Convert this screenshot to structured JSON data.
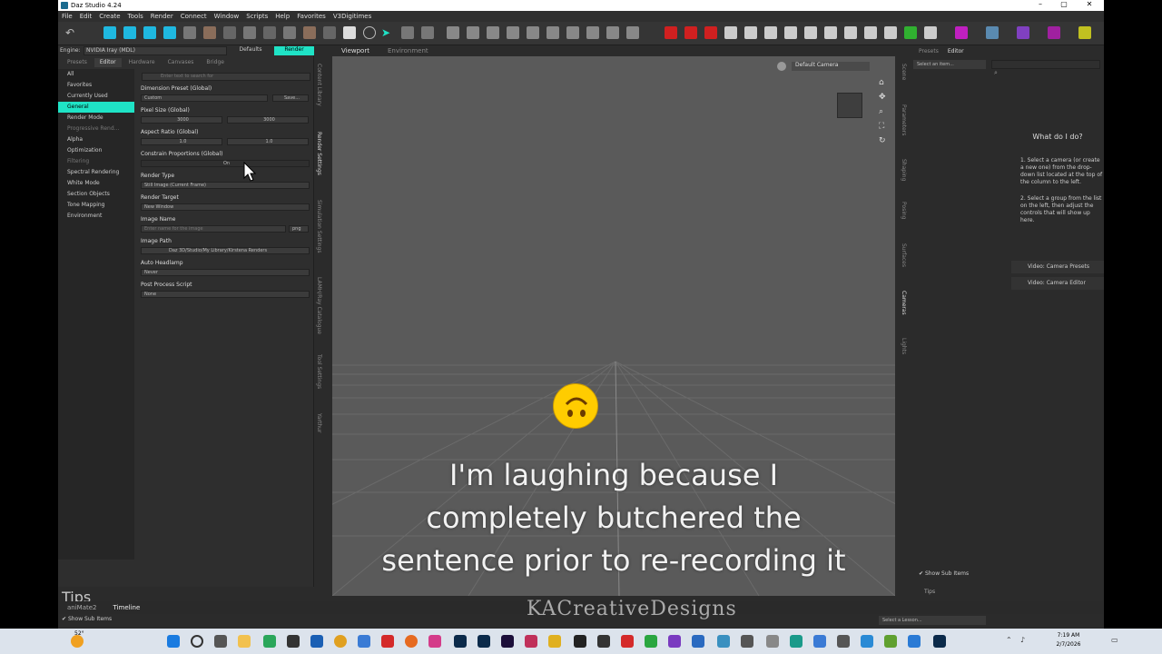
{
  "window": {
    "title": "Daz Studio 4.24",
    "minimize": "–",
    "maximize": "▢",
    "close": "✕"
  },
  "menu": [
    "File",
    "Edit",
    "Create",
    "Tools",
    "Render",
    "Connect",
    "Window",
    "Scripts",
    "Help",
    "Favorites",
    "V3Digitimes"
  ],
  "left_panel": {
    "engine_label": "Engine:",
    "engine_value": "NVIDIA Iray (MDL)",
    "defaults_label": "Defaults",
    "render_label": "Render",
    "tabs": [
      "Presets",
      "Editor",
      "Hardware",
      "Canvases",
      "Bridge"
    ],
    "active_tab": "Editor",
    "search_placeholder": "Enter text to search for",
    "categories": [
      {
        "label": "All"
      },
      {
        "label": "Favorites"
      },
      {
        "label": "Currently Used"
      },
      {
        "label": "General",
        "selected": true
      },
      {
        "label": "Render Mode"
      },
      {
        "label": "Progressive Rend..."
      },
      {
        "label": "Alpha"
      },
      {
        "label": "Optimization"
      },
      {
        "label": "Filtering"
      },
      {
        "label": "Spectral Rendering"
      },
      {
        "label": "White Mode"
      },
      {
        "label": "Section Objects"
      },
      {
        "label": "Tone Mapping"
      },
      {
        "label": "Environment"
      }
    ],
    "props": {
      "dimension_preset_label": "Dimension Preset (Global)",
      "dimension_preset_value": "Custom",
      "save_label": "Save...",
      "pixel_size_label": "Pixel Size (Global)",
      "pixel_w": "3000",
      "pixel_h": "3000",
      "aspect_label": "Aspect Ratio (Global)",
      "aspect_w": "1.0",
      "aspect_h": "1.0",
      "constrain_label": "Constrain Proportions (Global)",
      "constrain_value": "On",
      "render_type_label": "Render Type",
      "render_type_value": "Still Image (Current Frame)",
      "render_target_label": "Render Target",
      "render_target_value": "New Window",
      "image_name_label": "Image Name",
      "image_name_placeholder": "Enter name for the image",
      "image_ext": "png",
      "image_path_label": "Image Path",
      "image_path_value": "Daz 3D/Studio/My Library/Kirstena Renders",
      "headlamp_label": "Auto Headlamp",
      "headlamp_value": "Never",
      "post_script_label": "Post Process Script",
      "post_script_value": "None"
    },
    "show_sub_items": "Show Sub Items",
    "tips": "Tips"
  },
  "left_vtabs": [
    "Content Library",
    "Render Settings",
    "Simulation Settings",
    "LAMH/Ray Catalogue",
    "Tool Settings",
    "Yarthur"
  ],
  "viewport": {
    "tabs": [
      "Viewport",
      "Environment"
    ],
    "camera": "Default Camera",
    "subtitle_lines": [
      "I'm laughing because I",
      "completely butchered the",
      "sentence prior to re-recording it"
    ]
  },
  "right_vtabs": [
    "Scene",
    "Parameters",
    "Shaping",
    "Posing",
    "Surfaces",
    "Cameras",
    "Lights"
  ],
  "right_panel": {
    "tabs": [
      "Presets",
      "Editor"
    ],
    "select_item": "Select an item...",
    "help_title": "What do I do?",
    "help_steps": [
      "1. Select a camera (or create a new one) from the drop-down list located at the top of the column to the left.",
      "2. Select a group from the list on the left, then adjust the controls that will show up here."
    ],
    "video_links": [
      "Video: Camera Presets",
      "Video: Camera Editor"
    ],
    "show_sub_items": "Show Sub Items",
    "tips": "Tips"
  },
  "bottom": {
    "tabs": [
      "aniMate2",
      "Timeline"
    ],
    "active_tab": "Timeline",
    "watermark": "KACreativeDesigns",
    "lesson": "Select a Lesson..."
  },
  "taskbar": {
    "temperature": "52°",
    "time": "7:19 AM",
    "date": "2/7/2026"
  }
}
